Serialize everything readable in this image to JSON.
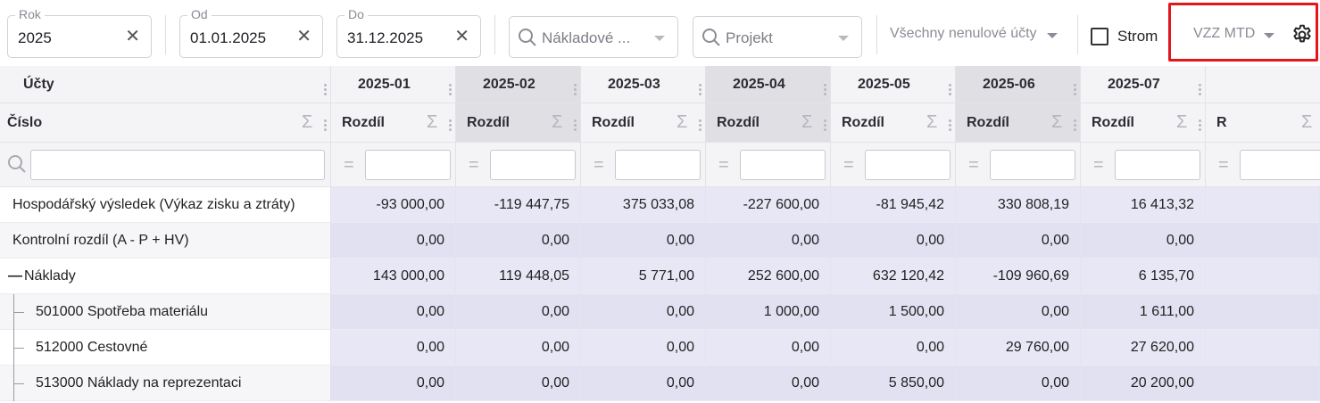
{
  "toolbar": {
    "year": {
      "label": "Rok",
      "value": "2025"
    },
    "from": {
      "label": "Od",
      "value": "01.01.2025"
    },
    "to": {
      "label": "Do",
      "value": "31.12.2025"
    },
    "clear_glyph": "✕",
    "cost_center": {
      "placeholder": "Nákladové ...",
      "icon": "search-icon"
    },
    "project": {
      "placeholder": "Projekt",
      "icon": "search-icon"
    },
    "accounts_filter": "Všechny nenulové účty",
    "tree_label": "Strom",
    "tree_checked": false,
    "report": "VZZ MTD",
    "settings_icon": "gear-icon",
    "highlight_color": "#e2161d"
  },
  "grid": {
    "account_header": "Účty",
    "number_header": "Číslo",
    "sigma": "Σ",
    "eq": "=",
    "months": [
      {
        "label": "2025-01",
        "sub": "Rozdíl",
        "shade": "light"
      },
      {
        "label": "2025-02",
        "sub": "Rozdíl",
        "shade": "dark"
      },
      {
        "label": "2025-03",
        "sub": "Rozdíl",
        "shade": "light"
      },
      {
        "label": "2025-04",
        "sub": "Rozdíl",
        "shade": "dark"
      },
      {
        "label": "2025-05",
        "sub": "Rozdíl",
        "shade": "light"
      },
      {
        "label": "2025-06",
        "sub": "Rozdíl",
        "shade": "dark"
      },
      {
        "label": "2025-07",
        "sub": "Rozdíl",
        "shade": "light"
      },
      {
        "label": "",
        "sub": "R",
        "shade": "light"
      }
    ],
    "rows": [
      {
        "name": "Hospodářský výsledek (Výkaz zisku a ztráty)",
        "level": 0,
        "values": [
          "-93 000,00",
          "-119 447,75",
          "375 033,08",
          "-227 600,00",
          "-81 945,42",
          "330 808,19",
          "16 413,32"
        ]
      },
      {
        "name": "Kontrolní rozdíl (A - P + HV)",
        "level": 0,
        "values": [
          "0,00",
          "0,00",
          "0,00",
          "0,00",
          "0,00",
          "0,00",
          "0,00"
        ]
      },
      {
        "name": "Náklady",
        "level": 0,
        "expander": "—",
        "values": [
          "143 000,00",
          "119 448,05",
          "5 771,00",
          "252 600,00",
          "632 120,42",
          "-109 960,69",
          "6 135,70"
        ]
      },
      {
        "name": "501000 Spotřeba materiálu",
        "level": 1,
        "values": [
          "0,00",
          "0,00",
          "0,00",
          "1 000,00",
          "1 500,00",
          "0,00",
          "1 611,00"
        ]
      },
      {
        "name": "512000 Cestovné",
        "level": 1,
        "values": [
          "0,00",
          "0,00",
          "0,00",
          "0,00",
          "0,00",
          "29 760,00",
          "27 620,00"
        ]
      },
      {
        "name": "513000 Náklady na reprezentaci",
        "level": 1,
        "values": [
          "0,00",
          "0,00",
          "0,00",
          "0,00",
          "5 850,00",
          "0,00",
          "20 200,00"
        ]
      }
    ]
  }
}
